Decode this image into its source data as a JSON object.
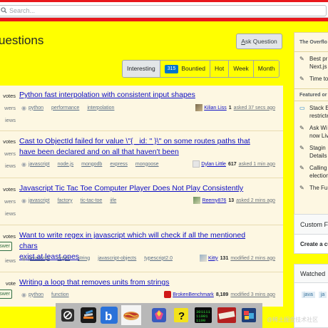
{
  "search": {
    "placeholder": "Search..."
  },
  "page": {
    "title": "uestions",
    "ask_button": "Ask Question"
  },
  "tabs": [
    {
      "label": "Interesting",
      "active": true
    },
    {
      "badge": "315",
      "label": "Bountied"
    },
    {
      "label": "Hot"
    },
    {
      "label": "Week"
    },
    {
      "label": "Month"
    }
  ],
  "questions": [
    {
      "stats": [
        "votes",
        "wers",
        "iews"
      ],
      "title_lines": [
        "Python fast interpolation with consistent input shapes"
      ],
      "tags": [
        "python",
        "performance",
        "interpolation"
      ],
      "user": "Kilian Liss",
      "rep": "1",
      "time": "asked 37 secs ago"
    },
    {
      "stats": [
        "votes",
        "wers",
        "iews"
      ],
      "title_lines": [
        "Cast to ObjectId failed for value \\\"{ _id: '' }\\\" on some routes paths that",
        "have been declared and on all that haven't been"
      ],
      "tags": [
        "javascript",
        "node.js",
        "mongodb",
        "express",
        "mongoose"
      ],
      "user": "Dylan Little",
      "rep": "617",
      "time": "asked 1 min ago"
    },
    {
      "stats": [
        "votes",
        "wers",
        "iews"
      ],
      "title_lines": [
        "Javascript Tic Tac Toe Computer Player Does Not Play Consistently"
      ],
      "tags": [
        "javascript",
        "factory",
        "tic-tac-toe",
        "iife"
      ],
      "user": "Reemy876",
      "rep": "13",
      "time": "asked 2 mins ago"
    },
    {
      "stats": [
        "votes",
        "swer",
        "iews"
      ],
      "title_lines": [
        "Want to write regex in javascript which will check if all the mentioned chars",
        "exist at least ones"
      ],
      "tags": [
        "javascript",
        "regex",
        "string",
        "javascript-objects",
        "typescript2.0"
      ],
      "user": "Kitty",
      "rep": "131",
      "time": "modified 2 mins ago"
    },
    {
      "stats": [
        "vote",
        "swer",
        ""
      ],
      "title_lines": [
        "Writing a loop that removes units from strings"
      ],
      "tags": [
        "python",
        "function"
      ],
      "user": "BrokenBenchmark",
      "rep": "8,189",
      "time": "modified 3 mins ago"
    }
  ],
  "sidebar": {
    "blog_title": "The Overflo",
    "blog_items": [
      "Best pr",
      "Next.js",
      "Time to"
    ],
    "featured_title": "Featured or",
    "featured_items": [
      "Stack E",
      "restricte",
      "Ask Wi",
      "now Liv",
      "Stagin",
      "Details",
      "Calling",
      "election",
      "The Fu"
    ],
    "custom_title": "Custom F",
    "custom_body": "Create a cu",
    "watched_title": "Watched",
    "watched_tags": [
      "java",
      "ja"
    ]
  },
  "watermark": "@稀土掘金技术社区",
  "icons": {
    "search": "search-icon",
    "eye": "eye-icon",
    "pen": "pen-icon",
    "chat": "chat-icon"
  },
  "colors": {
    "top_bar": "#e8181c",
    "page_bg": "#ffff00",
    "link": "#0c0dc4",
    "badge": "#0074cc"
  }
}
